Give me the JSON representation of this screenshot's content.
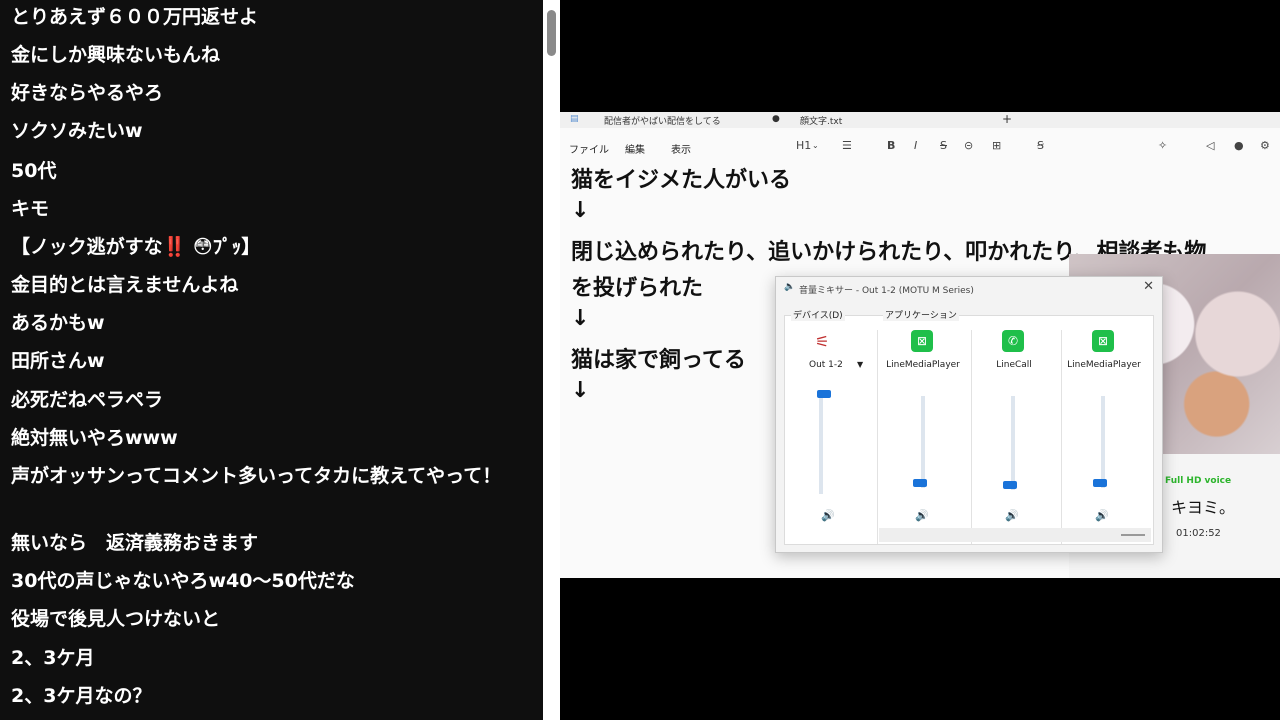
{
  "chat": {
    "messages": [
      "とりあえず６００万円返せよ",
      "金にしか興味ないもんね",
      "好きならやるやろ",
      "ソクソみたいw",
      "50代",
      "キモ",
      "【ノック逃がすな‼️ 😳ﾌﾟｯ】",
      "金目的とは言えませんよね",
      "あるかもw",
      "田所さんw",
      "必死だねペラペラ",
      "絶対無いやろwww",
      "声がオッサンってコメント多いってタカに教えてやって！",
      "無いなら　返済義務おきます",
      "30代の声じゃないやろw40〜50代だな",
      "役場で後見人つけないと",
      "2、3ケ月",
      "2、3ケ月なの？"
    ]
  },
  "editor": {
    "tabs": [
      "配信者がやばい配信をしてる",
      "顔文字.txt"
    ],
    "new_tab": "+",
    "menu": [
      "ファイル",
      "編集",
      "表示"
    ],
    "heading_tool": "H1",
    "lines": [
      "猫をイジメた人がいる",
      "↓",
      "閉じ込められたり、追いかけられたり、叩かれたり、相談者も物",
      "を投げられた",
      "↓",
      "猫は家で飼ってる",
      "↓"
    ]
  },
  "webcam": {
    "badge": "Full HD voice",
    "name": "キヨミ。",
    "time": "01:02:52"
  },
  "mixer": {
    "title": "音量ミキサー - Out 1-2 (MOTU M Series)",
    "device_label": "デバイス(D)",
    "apps_label": "アプリケーション",
    "device_name": "Out 1-2",
    "apps": [
      {
        "name": "LineMediaPlayer",
        "level": 0.15
      },
      {
        "name": "LineCall",
        "level": 0.12
      },
      {
        "name": "LineMediaPlayer",
        "level": 0.15
      }
    ],
    "device_level": 0.95,
    "colors": {
      "accent": "#1a73d9",
      "app_icon": "#1fbf4a"
    }
  }
}
